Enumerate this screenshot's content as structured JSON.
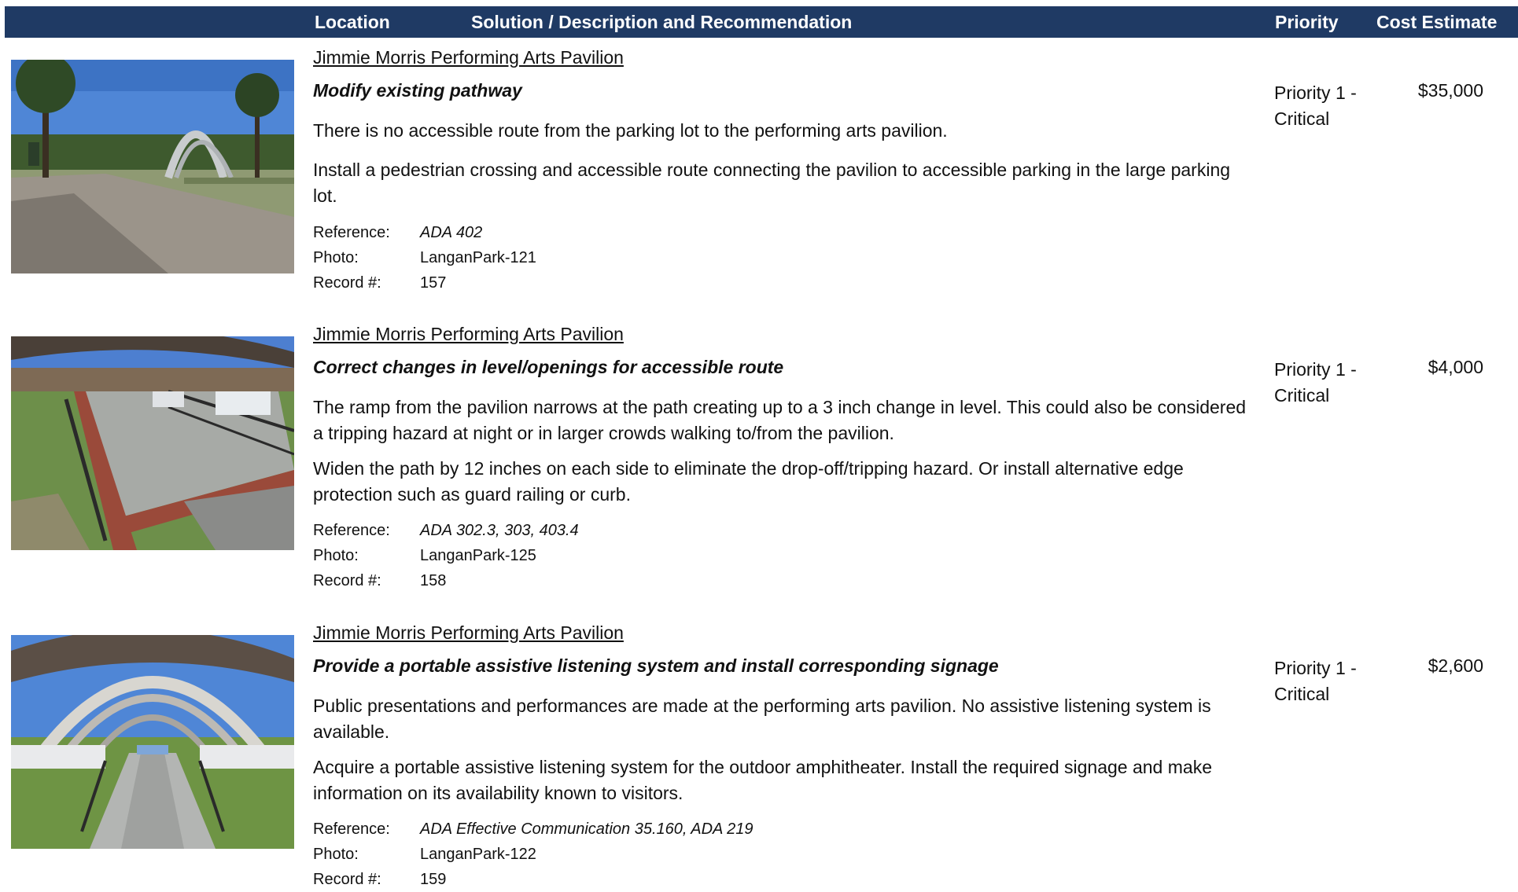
{
  "header": {
    "location": "Location",
    "solution": "Solution / Description and Recommendation",
    "priority": "Priority",
    "cost": "Cost Estimate"
  },
  "entries": [
    {
      "location": "Jimmie Morris Performing Arts Pavilion",
      "title": "Modify existing pathway",
      "description": "There is no accessible route from the parking lot to the performing arts pavilion.",
      "recommendation": "Install a pedestrian crossing and accessible route connecting the pavilion to accessible parking in the large parking lot.",
      "reference_label": "Reference:",
      "reference": "ADA 402",
      "photo_label": "Photo:",
      "photo": "LanganPark-121",
      "record_label": "Record #:",
      "record": "157",
      "priority": "Priority 1 - Critical",
      "cost": "$35,000"
    },
    {
      "location": "Jimmie Morris Performing Arts Pavilion",
      "title": "Correct changes in level/openings for accessible route",
      "description": "The ramp from the pavilion narrows at the path creating up to a 3 inch change in level.  This could also be considered a tripping hazard at night or in larger crowds walking to/from the pavilion.",
      "recommendation": "Widen the path by 12 inches on each side to eliminate the drop-off/tripping hazard.  Or install alternative edge protection such as guard railing or curb.",
      "reference_label": "Reference:",
      "reference": "ADA 302.3, 303, 403.4",
      "photo_label": "Photo:",
      "photo": "LanganPark-125",
      "record_label": "Record #:",
      "record": "158",
      "priority": "Priority 1 - Critical",
      "cost": "$4,000"
    },
    {
      "location": "Jimmie Morris Performing Arts Pavilion",
      "title": "Provide a portable assistive listening system and install corresponding signage",
      "description": "Public presentations and performances are made at the performing arts pavilion. No assistive listening system is available.",
      "recommendation": "Acquire a portable assistive listening system for the outdoor amphitheater. Install the required signage and make information on its availability known to visitors.",
      "reference_label": "Reference:",
      "reference": "ADA Effective Communication 35.160, ADA 219",
      "photo_label": "Photo:",
      "photo": "LanganPark-122",
      "record_label": "Record #:",
      "record": "159",
      "priority": "Priority 1 - Critical",
      "cost": "$2,600"
    }
  ]
}
